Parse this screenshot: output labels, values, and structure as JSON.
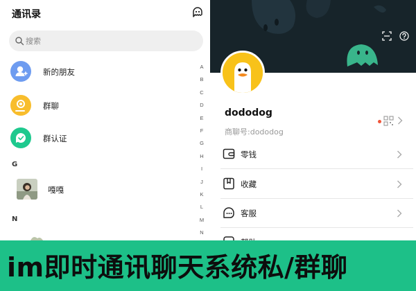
{
  "left": {
    "title": "通讯录",
    "header_icon": "ghost-chat-icon",
    "search": {
      "placeholder": "搜索",
      "icon": "search-icon"
    },
    "menu": [
      {
        "label": "新的朋友",
        "icon": "add-friend-icon",
        "color": "#6e9cf0"
      },
      {
        "label": "群聊",
        "icon": "group-chat-icon",
        "color": "#f8bd2c"
      },
      {
        "label": "群认证",
        "icon": "group-verify-icon",
        "color": "#1ec98e"
      }
    ],
    "sections": [
      {
        "letter": "G",
        "contacts": [
          {
            "name": "嘎嘎",
            "avatar": "photo-avatar"
          }
        ]
      },
      {
        "letter": "N",
        "contacts": []
      }
    ],
    "alphabet": [
      "A",
      "B",
      "C",
      "D",
      "E",
      "F",
      "G",
      "H",
      "I",
      "J",
      "K",
      "L",
      "M",
      "N"
    ]
  },
  "right": {
    "cover": {
      "scan_icon": "scan-icon",
      "help_icon": "help-circle-icon",
      "background": "#17242a"
    },
    "profile": {
      "name": "dododog",
      "id_text": "商聊号:dododog",
      "avatar": "duck-avatar",
      "avatar_color": "#f8c21a"
    },
    "qr": {
      "icon": "qr-code-icon",
      "dot_color": "#f0553a"
    },
    "rows": [
      {
        "label": "零钱",
        "icon": "wallet-icon"
      },
      {
        "label": "收藏",
        "icon": "bookmark-icon"
      },
      {
        "label": "客服",
        "icon": "customer-service-icon"
      },
      {
        "label": "帮助",
        "icon": "help-icon"
      }
    ]
  },
  "banner": {
    "text": "im即时通讯聊天系统私/群聊",
    "background": "#1dc088"
  }
}
